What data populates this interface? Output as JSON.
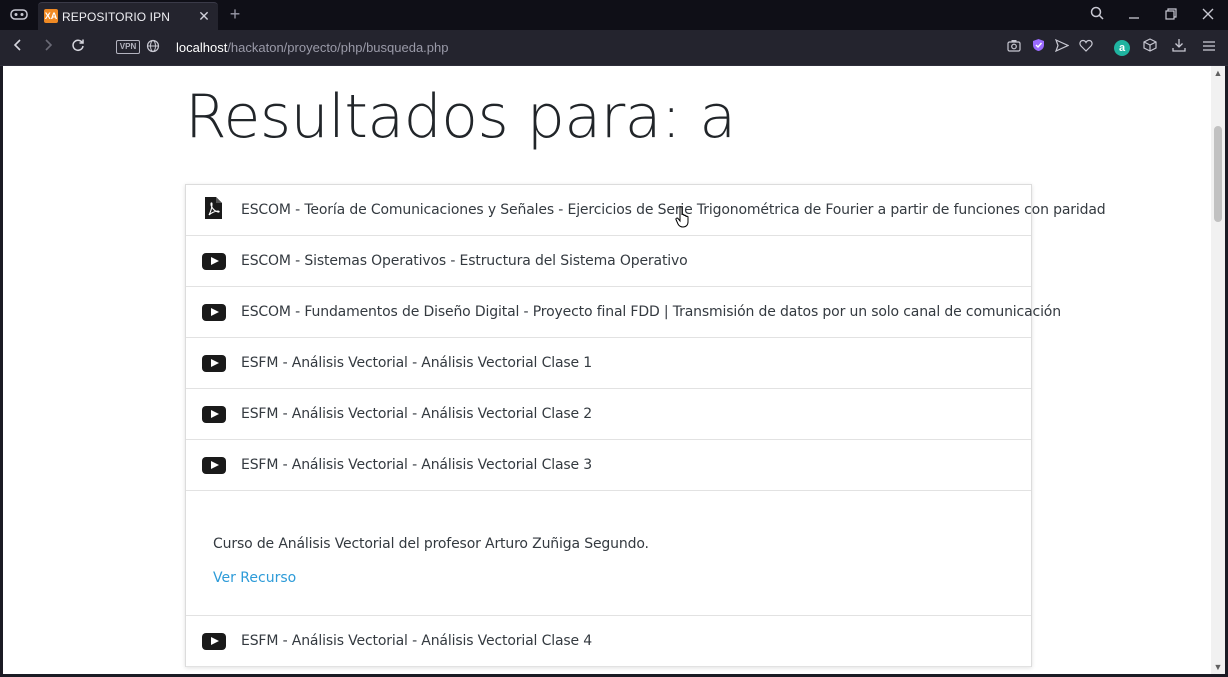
{
  "browser": {
    "tab_title": "REPOSITORIO IPN",
    "favicon_text": "XA",
    "new_tab": "+",
    "url_host": "localhost",
    "url_path": "/hackaton/proyecto/php/busqueda.php",
    "vpn_label": "VPN",
    "extension_letter": "a"
  },
  "page": {
    "title": "Resultados para: a",
    "results": [
      {
        "type": "pdf",
        "label": "ESCOM - Teoría de Comunicaciones y Señales - Ejercicios de Serie Trigonométrica de Fourier a partir de funciones con paridad"
      },
      {
        "type": "video",
        "label": "ESCOM - Sistemas Operativos - Estructura del Sistema Operativo"
      },
      {
        "type": "video",
        "label": "ESCOM - Fundamentos de Diseño Digital - Proyecto final FDD | Transmisión de datos por un solo canal de comunicación"
      },
      {
        "type": "video",
        "label": "ESFM - Análisis Vectorial - Análisis Vectorial Clase 1"
      },
      {
        "type": "video",
        "label": "ESFM - Análisis Vectorial - Análisis Vectorial Clase 2"
      },
      {
        "type": "video",
        "label": "ESFM - Análisis Vectorial - Análisis Vectorial Clase 3"
      },
      {
        "type": "video",
        "label": "ESFM - Análisis Vectorial - Análisis Vectorial Clase 4"
      }
    ],
    "expanded": {
      "description": "Curso de Análisis Vectorial del profesor Arturo Zuñiga Segundo.",
      "link": "Ver Recurso"
    }
  },
  "colors": {
    "link": "#2d9bd8",
    "chrome_bg": "#24242e",
    "tabbar_bg": "#0f0f17"
  }
}
